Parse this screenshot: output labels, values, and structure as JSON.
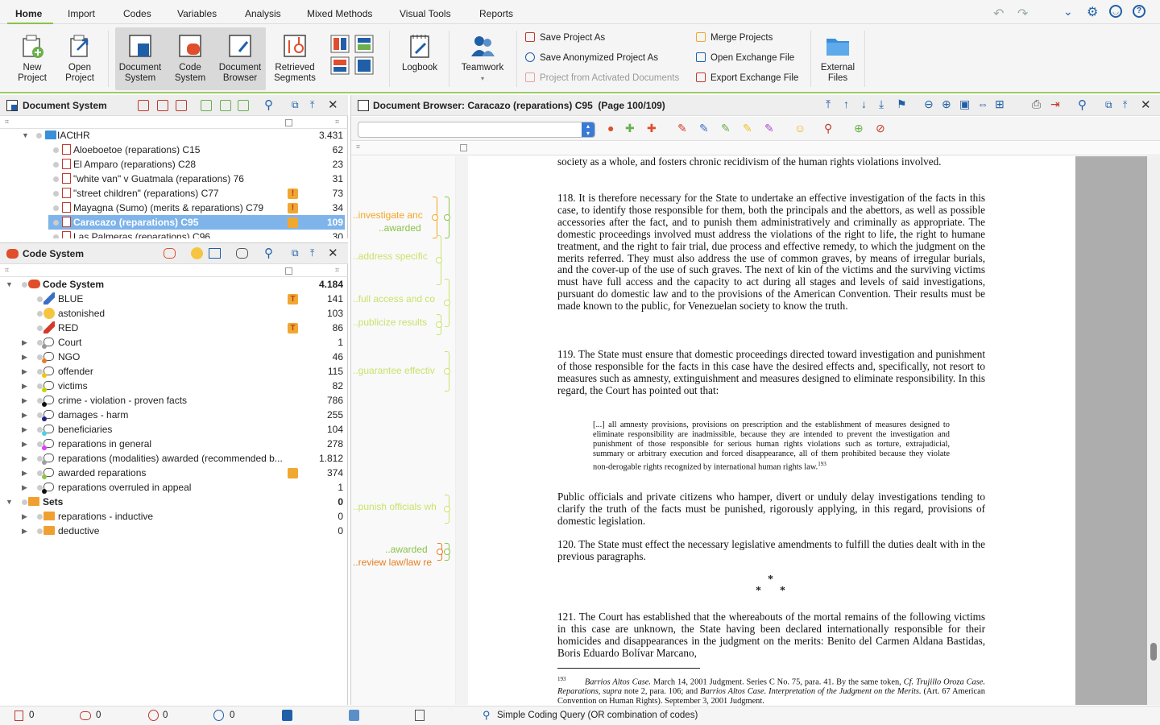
{
  "menu": {
    "tabs": [
      "Home",
      "Import",
      "Codes",
      "Variables",
      "Analysis",
      "Mixed Methods",
      "Visual Tools",
      "Reports"
    ],
    "active": "Home"
  },
  "ribbon": {
    "new_project": "New Project",
    "open_project": "Open Project",
    "document_system": "Document System",
    "code_system": "Code System",
    "document_browser": "Document Browser",
    "retrieved_segments": "Retrieved Segments",
    "logbook": "Logbook",
    "teamwork": "Teamwork",
    "save_project_as": "Save Project As",
    "save_anonymized": "Save Anonymized Project As",
    "project_from_activated": "Project from Activated Documents",
    "merge_projects": "Merge Projects",
    "open_exchange": "Open Exchange File",
    "export_exchange": "Export Exchange File",
    "external_files": "External Files"
  },
  "document_system": {
    "title": "Document System",
    "root": {
      "label": "IACtHR",
      "count": "3.431"
    },
    "items": [
      {
        "label": "Aloeboetoe (reparations) C15",
        "count": "62",
        "memo": false,
        "selected": false
      },
      {
        "label": "El Amparo (reparations) C28",
        "count": "23",
        "memo": false,
        "selected": false
      },
      {
        "label": "\"white van\" v Guatmala (reparations) 76",
        "count": "31",
        "memo": false,
        "selected": false
      },
      {
        "label": "\"street children\" (reparations) C77",
        "count": "73",
        "memo": true,
        "selected": false
      },
      {
        "label": "Mayagna (Sumo) (merits & reparations) C79",
        "count": "34",
        "memo": true,
        "selected": false
      },
      {
        "label": "Caracazo (reparations) C95",
        "count": "109",
        "memo": true,
        "selected": true
      },
      {
        "label": "Las Palmeras (reparations) C96",
        "count": "30",
        "memo": false,
        "selected": false
      }
    ]
  },
  "code_system": {
    "title": "Code System",
    "root": {
      "label": "Code System",
      "count": "4.184"
    },
    "items": [
      {
        "label": "BLUE",
        "count": "141",
        "memo": "T",
        "icon": "pen-blue",
        "expandable": false
      },
      {
        "label": "astonished",
        "count": "103",
        "memo": "",
        "icon": "emoji",
        "expandable": false
      },
      {
        "label": "RED",
        "count": "86",
        "memo": "T",
        "icon": "pen-red",
        "expandable": false
      },
      {
        "label": "Court",
        "count": "1",
        "memo": "",
        "icon": "code",
        "color": "#999999",
        "expandable": true
      },
      {
        "label": "NGO",
        "count": "46",
        "memo": "",
        "icon": "code",
        "color": "#e67e22",
        "expandable": true
      },
      {
        "label": "offender",
        "count": "115",
        "memo": "",
        "icon": "code",
        "color": "#f1c40f",
        "expandable": true
      },
      {
        "label": "victims",
        "count": "82",
        "memo": "",
        "icon": "code",
        "color": "#c8d400",
        "expandable": true
      },
      {
        "label": "crime - violation - proven facts",
        "count": "786",
        "memo": "",
        "icon": "code",
        "color": "#111111",
        "expandable": true
      },
      {
        "label": "damages - harm",
        "count": "255",
        "memo": "",
        "icon": "code",
        "color": "#1a237e",
        "expandable": true
      },
      {
        "label": "beneficiaries",
        "count": "104",
        "memo": "",
        "icon": "code",
        "color": "#4dd0e1",
        "expandable": true
      },
      {
        "label": "reparations in general",
        "count": "278",
        "memo": "",
        "icon": "code",
        "color": "#e040fb",
        "expandable": true
      },
      {
        "label": "reparations (modalities) awarded (recommended b...",
        "count": "1.812",
        "memo": "",
        "icon": "code",
        "color": "#9e9e9e",
        "expandable": true
      },
      {
        "label": "awarded reparations",
        "count": "374",
        "memo": "note",
        "icon": "code",
        "color": "#8bc34a",
        "expandable": true
      },
      {
        "label": "reparations overruled in appeal",
        "count": "1",
        "memo": "",
        "icon": "code",
        "color": "#111111",
        "expandable": true
      }
    ],
    "sets": {
      "label": "Sets",
      "count": "0"
    },
    "set_items": [
      {
        "label": "reparations - inductive",
        "count": "0"
      },
      {
        "label": "deductive",
        "count": "0"
      }
    ]
  },
  "browser": {
    "title": "Document Browser: Caracazo (reparations) C95",
    "page": "(Page 100/109)",
    "segments": [
      {
        "label": "..investigate anc",
        "color": "#f5a623"
      },
      {
        "label": "..awarded",
        "color": "#8bc34a"
      },
      {
        "label": "..address specific",
        "color": "#c8e26b"
      },
      {
        "label": "..full access and co",
        "color": "#c8e26b"
      },
      {
        "label": "..publicize results",
        "color": "#c8e26b"
      },
      {
        "label": "..guarantee effectiv",
        "color": "#c8e26b"
      },
      {
        "label": "..punish officials wh",
        "color": "#c8e26b"
      },
      {
        "label": "..awarded",
        "color": "#8bc34a"
      },
      {
        "label": "..review law/law re",
        "color": "#e67e22"
      }
    ],
    "text": {
      "p_top": "society as a whole, and fosters chronic recidivism of the human rights violations involved.",
      "p118": "118.   It is therefore necessary for the State to undertake an effective investigation of the facts in this case, to identify those responsible for them, both the principals and the abettors, as well as possible accessories after the fact, and to punish them administratively and criminally as appropriate.  The domestic proceedings involved must address the violations of the right to life, the right to humane treatment, and the right to fair trial, due process and effective remedy, to which the judgment on the merits referred.  They must also address the use of common graves, by means of irregular burials, and the cover-up of the use of such graves.  The next of kin of the victims and the surviving victims must have full access and the capacity to act during all stages and levels of said investigations, pursuant do domestic law and to the provisions of the American Convention.  Their results must be made known to the public, for Venezuelan society to know the truth.",
      "p119": "119.  The State must ensure that domestic proceedings directed toward investigation and punishment of those responsible for the facts in this case have the desired effects and, specifically, not resort to measures such as amnesty, extinguishment and measures designed to eliminate responsibility. In this regard, the Court has pointed out that:",
      "quote": "[...] all amnesty provisions, provisions on prescription and the establishment of measures designed to eliminate responsibility are inadmissible, because they are intended to prevent the investigation and punishment of those responsible for serious human rights violations such as torture, extrajudicial, summary or arbitrary execution and forced disappearance, all of them prohibited because they violate non-derogable rights recognized by international human rights law.",
      "quote_ref": "193",
      "p_public": "Public officials and private citizens who hamper, divert or unduly delay investigations tending to clarify the truth of the facts must be punished, rigorously applying, in this regard, provisions of domestic legislation.",
      "p120": "120.   The State must effect the necessary legislative amendments to fulfill the duties dealt with in the previous paragraphs.",
      "stars": "* * *",
      "p121": "121.   The Court has established that the whereabouts of the mortal remains of the following victims in this case are unknown, the State having been declared internationally responsible  for their homicides and disappearances in the judgment on the merits: Benito del Carmen Aldana Bastidas, Boris Eduardo Bolívar Marcano,",
      "footnote_num": "193",
      "footnote_a": "Barrios Altos Case.",
      "footnote_b": " March 14, 2001 Judgment. Series C No. 75, para. 41.  By the same token, ",
      "footnote_c": "Cf. Trujillo Oroza Case. Reparations, supra",
      "footnote_d": " note 2, para. 106; and ",
      "footnote_e": "Barrios Altos Case. Interpretation of the Judgment on the Merits.",
      "footnote_f": " (Art. 67 American Convention on Human Rights). September 3, 2001 Judgment."
    }
  },
  "status": {
    "docs": "0",
    "codes": "0",
    "coded1": "0",
    "coded2": "0",
    "query": "Simple Coding Query (OR combination of codes)"
  },
  "colors": {
    "accent_green": "#8bc34a",
    "selection_blue": "#7eb4ea",
    "memo_orange": "#f0a830"
  }
}
